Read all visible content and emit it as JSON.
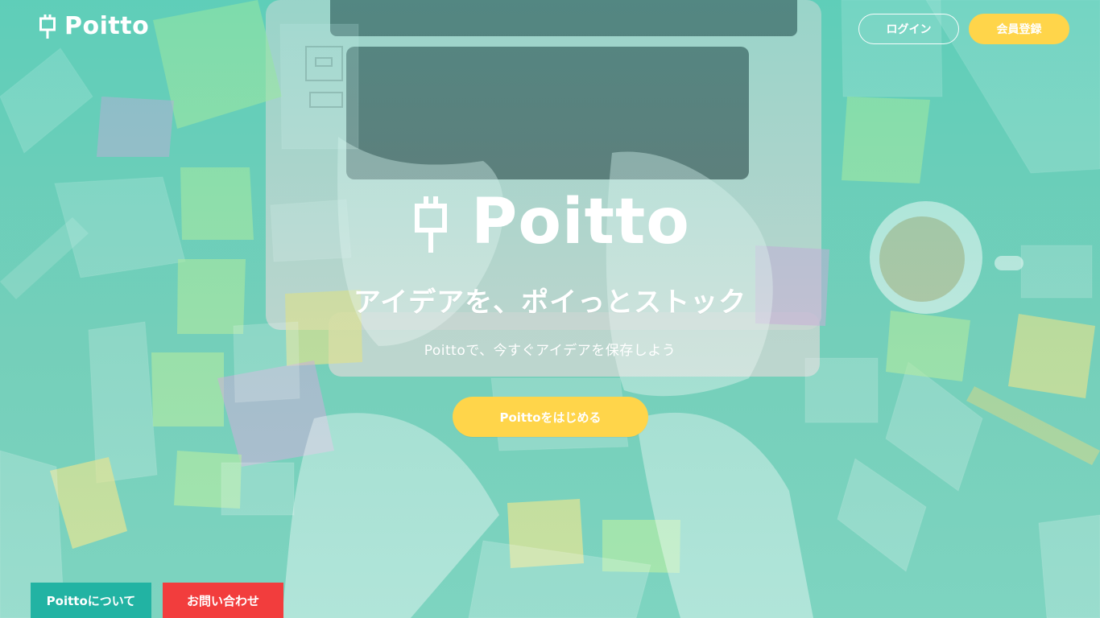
{
  "brand": {
    "name": "Poitto"
  },
  "header": {
    "login_label": "ログイン",
    "signup_label": "会員登録"
  },
  "hero": {
    "logo_text": "Poitto",
    "title": "アイデアを、ポイっとストック",
    "subtitle": "Poittoで、今すぐアイデアを保存しよう",
    "cta_label": "Poittoをはじめる"
  },
  "footer": {
    "about_label": "Poittoについて",
    "contact_label": "お問い合わせ"
  },
  "icons": {
    "brand_mark": "plug-icon"
  },
  "colors": {
    "accent_yellow": "#ffd54a",
    "teal": "#22b3a3",
    "red": "#f23d3d"
  }
}
